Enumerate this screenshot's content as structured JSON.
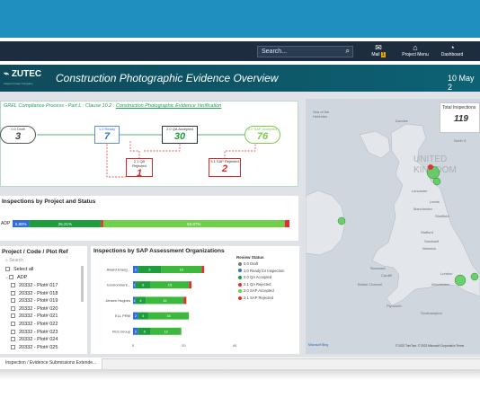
{
  "navbar": {
    "search_placeholder": "Search...",
    "items": [
      {
        "label": "Mail",
        "badge": "1"
      },
      {
        "label": "Project Menu"
      },
      {
        "label": "Dashboard"
      }
    ]
  },
  "header": {
    "logo": "ZUTEC",
    "logo_subtitle": "Inspect Group Company",
    "title": "Construction Photographic Evidence Overview",
    "date": "10 May 2"
  },
  "process": {
    "title_prefix": "GREL Compliance Process - Part L : Clause 10.2 : ",
    "title_link": "Construction Photographic Evidence Verification",
    "stages": [
      {
        "label": "0.0 Draft",
        "value": "3",
        "color": "#444444"
      },
      {
        "label": "1.0 Ready",
        "value": "7",
        "color": "#2f6fdc"
      },
      {
        "label": "2.0 QA Accepted",
        "value": "30",
        "color": "#1e9e3a"
      },
      {
        "label": "3.0 SAP Accepted",
        "value": "76",
        "color": "#7dc94e"
      },
      {
        "label": "2.1 QA Rejected",
        "value": "1",
        "color": "#d62a2a"
      },
      {
        "label": "3.1 SAP Rejected",
        "value": "2",
        "color": "#d62a2a"
      }
    ]
  },
  "stacked": {
    "title": "Inspections by Project and Status",
    "category": "ADP",
    "segments": [
      {
        "status": "1.0 Ready for Inspection",
        "percent": 5.88,
        "label": "5.88%",
        "color": "#2f6fdc"
      },
      {
        "status": "2.0 QA Accepted",
        "percent": 25.21,
        "label": "25.21%",
        "color": "#1e9e3a"
      },
      {
        "status": "2.1 QA Rejected",
        "percent": 0.84,
        "label": "",
        "color": "#e03030"
      },
      {
        "status": "3.0 SAP Accepted",
        "percent": 63.87,
        "label": "63.87%",
        "color": "#6fd04a"
      },
      {
        "status": "3.1 SAP Rejected",
        "percent": 1.68,
        "label": "",
        "color": "#e03030"
      }
    ]
  },
  "slicer": {
    "title": "Project / Code / Plot Ref",
    "search_placeholder": "Search",
    "select_all": "Select all",
    "project": "ADP",
    "plots": [
      "20332 - Plot# 017",
      "20332 - Plot# 018",
      "20332 - Plot# 019",
      "20332 - Plot# 020",
      "20332 - Plot# 021",
      "20332 - Plot# 022",
      "20332 - Plot# 023",
      "20332 - Plot# 024",
      "20332 - Plot# 025"
    ]
  },
  "chart_data": {
    "type": "bar",
    "orientation": "horizontal",
    "stacked": true,
    "title": "Inspections by SAP Assessment Organizations",
    "categories": [
      "Award Energ...",
      "Environment...",
      "Jensen Hughes",
      "ELL PRM",
      "FES Group"
    ],
    "series": [
      {
        "name": "1.0 Ready for Inspection",
        "color": "#2f6fdc",
        "values": [
          2,
          1,
          1,
          2,
          2
        ]
      },
      {
        "name": "2.0 QA Accepted",
        "color": "#1e9e3a",
        "values": [
          9,
          6,
          4,
          4,
          5
        ]
      },
      {
        "name": "3.0 SAP Accepted",
        "color": "#3cb83c",
        "values": [
          16,
          15,
          15,
          16,
          12
        ]
      },
      {
        "name": "3.1 SAP Rejected",
        "color": "#e03030",
        "values": [
          1,
          1,
          1,
          0,
          0
        ]
      }
    ],
    "data_labels": [
      [
        "2",
        "9",
        "16",
        ""
      ],
      [
        "1",
        "6",
        "15",
        ""
      ],
      [
        "1",
        "4",
        "15",
        ""
      ],
      [
        "2",
        "4",
        "16",
        ""
      ],
      [
        "2",
        "5",
        "12",
        ""
      ]
    ],
    "xlim": [
      0,
      40
    ],
    "xticks": [
      "0",
      "20",
      "40"
    ],
    "legend": {
      "title": "Review Status",
      "position": "right",
      "items": [
        {
          "label": "0.0 Draft",
          "color": "#777777"
        },
        {
          "label": "1.0 Ready for Inspection",
          "color": "#2f6fdc"
        },
        {
          "label": "2.0 QA Accepted",
          "color": "#1e9e3a"
        },
        {
          "label": "2.1 QA Rejected",
          "color": "#e03030"
        },
        {
          "label": "3.0 SAP Accepted",
          "color": "#6fd04a"
        },
        {
          "label": "3.1 SAP Rejected",
          "color": "#e03030"
        }
      ]
    }
  },
  "map": {
    "total_label": "Total Inspections",
    "total_value": "119",
    "labels": [
      "Isle of Man",
      "Dublin",
      "UNITED KINGDOM",
      "Leeds",
      "Manchester",
      "Sheffield",
      "Nottingham",
      "Birmingham",
      "Norwich",
      "Cardiff",
      "London",
      "Bristol",
      "Southampton",
      "Plymouth",
      "Lancaster",
      "Stafford",
      "Bath",
      "Swansea",
      "Leicester",
      "Sandwell",
      "Durham",
      "Sea of the Hebrides",
      "Irish Sea",
      "North Sea",
      "Bristol Channel",
      "Winchester",
      "Stockport",
      "Coventry",
      "Merthyr Tydfil",
      "Preston",
      "Warwick"
    ],
    "microsoft": "Microsoft Bing",
    "credit": "© 2022 TomTom, © 2022 Microsoft Corporation  Terms"
  },
  "footer": {
    "tab_label": "Inspection / Evidence Submissions Extende..."
  }
}
